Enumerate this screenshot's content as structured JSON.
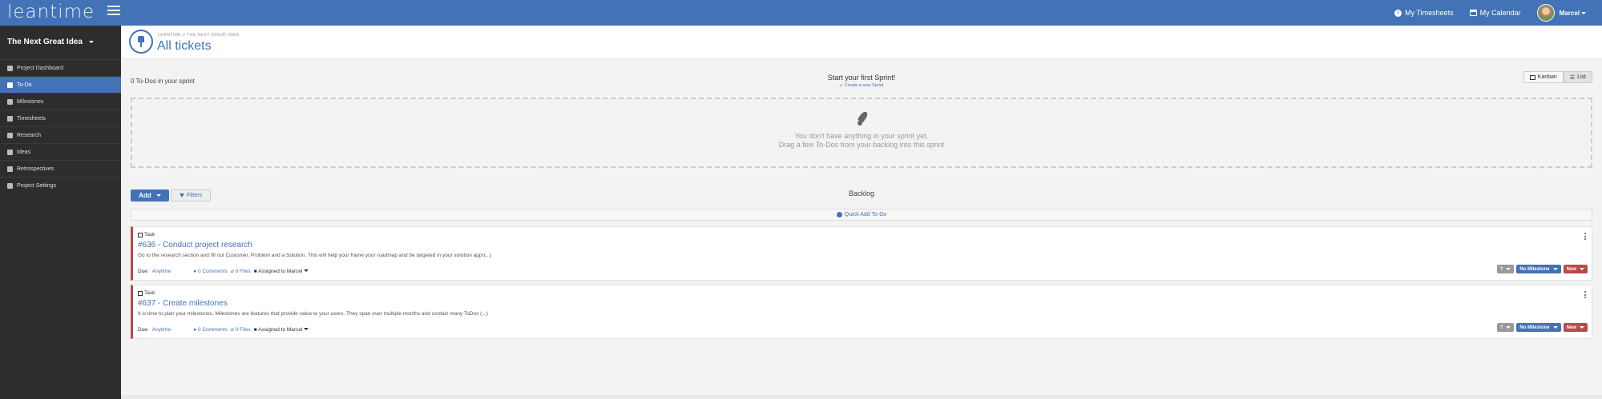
{
  "app": {
    "logo": "leantime"
  },
  "topbar": {
    "timesheets": "My Timesheets",
    "calendar": "My Calendar",
    "user": "Marcel"
  },
  "sidebar": {
    "project": "The Next Great Idea",
    "items": [
      {
        "label": "Project Dashboard",
        "icon": "home-icon"
      },
      {
        "label": "To-Do",
        "icon": "pin-icon",
        "active": true
      },
      {
        "label": "Milestones",
        "icon": "milestones-icon"
      },
      {
        "label": "Timesheets",
        "icon": "clock-icon"
      },
      {
        "label": "Research",
        "icon": "user-icon"
      },
      {
        "label": "Ideas",
        "icon": "lightbulb-icon"
      },
      {
        "label": "Retrospectives",
        "icon": "retro-icon"
      },
      {
        "label": "Project Settings",
        "icon": "gear-icon"
      }
    ]
  },
  "header": {
    "breadcrumb": "LEANTIME // THE NEXT GREAT IDEA",
    "title": "All tickets"
  },
  "sprint": {
    "count": "0 To-Dos in your sprint",
    "start": "Start your first Sprint!",
    "create": "Create a new Sprint",
    "empty_line1": "You don't have anything in your sprint yet.",
    "empty_line2": "Drag a few To-Dos from your backlog into this sprint"
  },
  "view": {
    "kanban": "Kanban",
    "list": "List"
  },
  "toolbar": {
    "add": "Add",
    "filters": "Filters"
  },
  "backlog": {
    "label": "Backlog",
    "quick_add": "Quick Add To-Do"
  },
  "tickets": [
    {
      "type": "Task",
      "title": "#636 - Conduct project research",
      "desc": "Go to the research section and fill out Customer, Problem and a Solution. This will help your frame your roadmap and be targeted in your solution appr(...)",
      "due_label": "Due:",
      "due": "Anytime",
      "comments": "0 Comments",
      "files": "0 Files",
      "assigned": "Assigned to Marcel",
      "priority": "?",
      "milestone": "No Milestone",
      "status": "New"
    },
    {
      "type": "Task",
      "title": "#637 - Create milestones",
      "desc": "It is time to plan your milestones. Milestones are features that provide value to your users. They span over multiple months and contain many ToDos (...)",
      "due_label": "Due:",
      "due": "Anytime",
      "comments": "0 Comments",
      "files": "0 Files",
      "assigned": "Assigned to Marcel",
      "priority": "?",
      "milestone": "No Milestone",
      "status": "New"
    }
  ],
  "colors": {
    "primary": "#4372b7",
    "sidebar": "#2d2d2d",
    "danger": "#b94a48"
  }
}
